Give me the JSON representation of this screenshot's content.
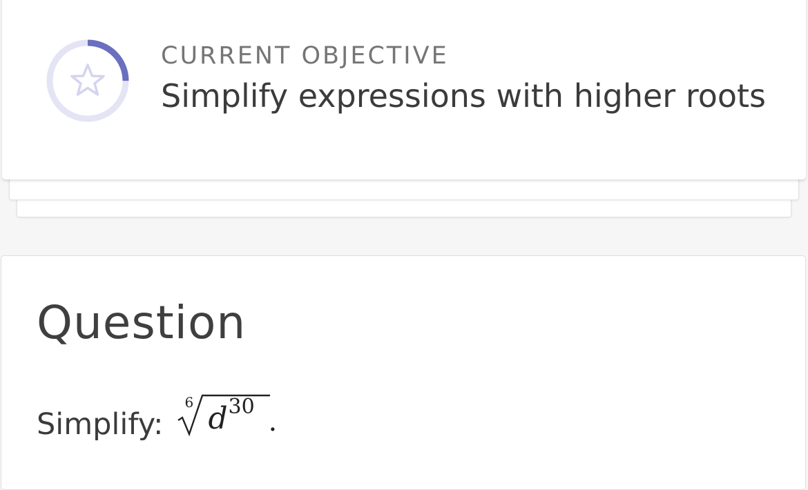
{
  "objective": {
    "eyebrow": "CURRENT OBJECTIVE",
    "title": "Simplify expressions with higher roots",
    "progress_fraction": 0.25,
    "progress_icon": "star-icon",
    "colors": {
      "ring_track": "#e4e4f5",
      "ring_progress": "#6b6fbf",
      "star": "#d4d4ee"
    }
  },
  "question": {
    "heading": "Question",
    "prompt_label": "Simplify:",
    "expression": {
      "root_index": "6",
      "base": "d",
      "exponent": "30",
      "trailing": "."
    }
  }
}
